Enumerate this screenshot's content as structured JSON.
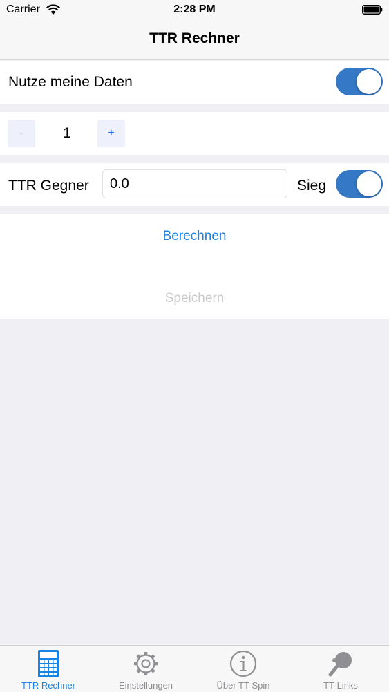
{
  "status_bar": {
    "carrier": "Carrier",
    "time": "2:28 PM"
  },
  "nav": {
    "title": "TTR Rechner"
  },
  "own_data": {
    "label": "Nutze meine Daten",
    "enabled": true
  },
  "stepper": {
    "minus_label": "-",
    "value": "1",
    "plus_label": "+"
  },
  "opponent": {
    "label": "TTR Gegner",
    "value": "0.0",
    "win_label": "Sieg",
    "win_enabled": true
  },
  "actions": {
    "calculate_label": "Berechnen",
    "save_label": "Speichern"
  },
  "tabs": [
    {
      "label": "TTR Rechner",
      "icon": "calculator-icon",
      "active": true
    },
    {
      "label": "Einstellungen",
      "icon": "gear-icon",
      "active": false
    },
    {
      "label": "Über TT-Spin",
      "icon": "info-icon",
      "active": false
    },
    {
      "label": "TT-Links",
      "icon": "paddle-icon",
      "active": false
    }
  ],
  "colors": {
    "accent": "#1a82e2",
    "switch_on": "#3478c6",
    "disabled_text": "#c9c9cc",
    "background": "#efeff4"
  }
}
